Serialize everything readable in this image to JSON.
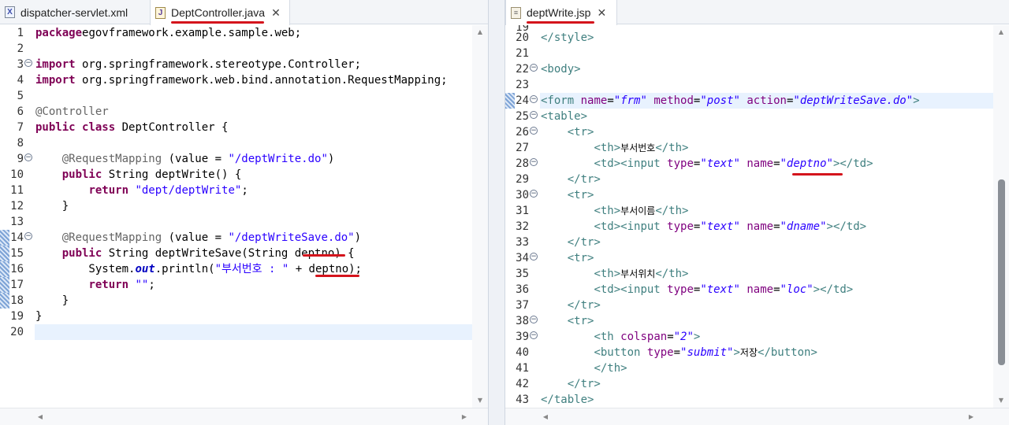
{
  "left_editor": {
    "tabs": [
      {
        "label": "dispatcher-servlet.xml",
        "icon": "xml-file-icon",
        "active": false
      },
      {
        "label": "DeptController.java",
        "icon": "java-file-icon",
        "active": true
      }
    ],
    "lines": [
      {
        "n": "1",
        "parts": [
          [
            "kw",
            "package"
          ],
          [
            "",
            "egovframework.example.sample.web;"
          ]
        ]
      },
      {
        "n": "2",
        "parts": []
      },
      {
        "n": "3",
        "fold": true,
        "parts": [
          [
            "kw",
            "import"
          ],
          [
            "",
            " org.springframework.stereotype.Controller;"
          ]
        ]
      },
      {
        "n": "4",
        "parts": [
          [
            "kw",
            "import"
          ],
          [
            "",
            " org.springframework.web.bind.annotation.RequestMapping;"
          ]
        ]
      },
      {
        "n": "5",
        "parts": []
      },
      {
        "n": "6",
        "parts": [
          [
            "ann",
            "@Controller"
          ]
        ]
      },
      {
        "n": "7",
        "parts": [
          [
            "kw",
            "public"
          ],
          [
            "",
            " "
          ],
          [
            "kw",
            "class"
          ],
          [
            "",
            " DeptController {"
          ]
        ]
      },
      {
        "n": "8",
        "parts": []
      },
      {
        "n": "9",
        "fold": true,
        "parts": [
          [
            "",
            "    "
          ],
          [
            "ann",
            "@RequestMapping"
          ],
          [
            "",
            " (value = "
          ],
          [
            "str",
            "\"/deptWrite.do\""
          ],
          [
            "",
            ")"
          ]
        ]
      },
      {
        "n": "10",
        "parts": [
          [
            "",
            "    "
          ],
          [
            "kw",
            "public"
          ],
          [
            "",
            " String deptWrite() {"
          ]
        ]
      },
      {
        "n": "11",
        "parts": [
          [
            "",
            "        "
          ],
          [
            "kw",
            "return"
          ],
          [
            "",
            " "
          ],
          [
            "str",
            "\"dept/deptWrite\""
          ],
          [
            "",
            ";"
          ]
        ]
      },
      {
        "n": "12",
        "parts": [
          [
            "",
            "    }"
          ]
        ]
      },
      {
        "n": "13",
        "parts": []
      },
      {
        "n": "14",
        "fold": true,
        "mark": true,
        "parts": [
          [
            "",
            "    "
          ],
          [
            "ann",
            "@RequestMapping"
          ],
          [
            "",
            " (value = "
          ],
          [
            "str",
            "\"/deptWriteSave.do\""
          ],
          [
            "",
            ")"
          ]
        ]
      },
      {
        "n": "15",
        "mark": true,
        "parts": [
          [
            "",
            "    "
          ],
          [
            "kw",
            "public"
          ],
          [
            "",
            " String deptWriteSave(String deptno) {"
          ]
        ]
      },
      {
        "n": "16",
        "mark": true,
        "parts": [
          [
            "",
            "        System."
          ],
          [
            "fld",
            "out"
          ],
          [
            "",
            ".println("
          ],
          [
            "str",
            "\"부서번호 : \""
          ],
          [
            "",
            " + deptno);"
          ]
        ]
      },
      {
        "n": "17",
        "mark": true,
        "parts": [
          [
            "",
            "        "
          ],
          [
            "kw",
            "return"
          ],
          [
            "",
            " "
          ],
          [
            "str",
            "\"\""
          ],
          [
            "",
            ";"
          ]
        ]
      },
      {
        "n": "18",
        "mark": true,
        "parts": [
          [
            "",
            "    }"
          ]
        ]
      },
      {
        "n": "19",
        "parts": [
          [
            "",
            "}"
          ]
        ]
      },
      {
        "n": "20",
        "current": true,
        "parts": []
      }
    ]
  },
  "right_editor": {
    "tabs": [
      {
        "label": "deptWrite.jsp",
        "icon": "jsp-file-icon",
        "active": true
      }
    ],
    "partial_top_line": "19",
    "lines": [
      {
        "n": "20",
        "parts": [
          [
            "tag",
            "</style>"
          ]
        ]
      },
      {
        "n": "21",
        "parts": []
      },
      {
        "n": "22",
        "fold": true,
        "parts": [
          [
            "tag",
            "<body>"
          ]
        ]
      },
      {
        "n": "23",
        "parts": []
      },
      {
        "n": "24",
        "fold": true,
        "mark": true,
        "current": true,
        "parts": [
          [
            "tag",
            "<form"
          ],
          [
            "",
            " "
          ],
          [
            "att",
            "name"
          ],
          [
            "",
            "="
          ],
          [
            "aval",
            "\"frm\""
          ],
          [
            "",
            " "
          ],
          [
            "att",
            "method"
          ],
          [
            "",
            "="
          ],
          [
            "aval",
            "\"post\""
          ],
          [
            "",
            " "
          ],
          [
            "att",
            "action"
          ],
          [
            "",
            "="
          ],
          [
            "aval",
            "\"deptWriteSave.do\""
          ],
          [
            "tag",
            ">"
          ]
        ]
      },
      {
        "n": "25",
        "fold": true,
        "parts": [
          [
            "tag",
            "<table>"
          ]
        ]
      },
      {
        "n": "26",
        "fold": true,
        "parts": [
          [
            "",
            "    "
          ],
          [
            "tag",
            "<tr>"
          ]
        ]
      },
      {
        "n": "27",
        "parts": [
          [
            "",
            "        "
          ],
          [
            "tag",
            "<th>"
          ],
          [
            "ko",
            "부서번호"
          ],
          [
            "tag",
            "</th>"
          ]
        ]
      },
      {
        "n": "28",
        "fold": true,
        "parts": [
          [
            "",
            "        "
          ],
          [
            "tag",
            "<td><input"
          ],
          [
            "",
            " "
          ],
          [
            "att",
            "type"
          ],
          [
            "",
            "="
          ],
          [
            "aval",
            "\"text\""
          ],
          [
            "",
            " "
          ],
          [
            "att",
            "name"
          ],
          [
            "",
            "="
          ],
          [
            "aval",
            "\"deptno\""
          ],
          [
            "tag",
            "></td>"
          ]
        ]
      },
      {
        "n": "29",
        "parts": [
          [
            "",
            "    "
          ],
          [
            "tag",
            "</tr>"
          ]
        ]
      },
      {
        "n": "30",
        "fold": true,
        "parts": [
          [
            "",
            "    "
          ],
          [
            "tag",
            "<tr>"
          ]
        ]
      },
      {
        "n": "31",
        "parts": [
          [
            "",
            "        "
          ],
          [
            "tag",
            "<th>"
          ],
          [
            "ko",
            "부서이름"
          ],
          [
            "tag",
            "</th>"
          ]
        ]
      },
      {
        "n": "32",
        "parts": [
          [
            "",
            "        "
          ],
          [
            "tag",
            "<td><input"
          ],
          [
            "",
            " "
          ],
          [
            "att",
            "type"
          ],
          [
            "",
            "="
          ],
          [
            "aval",
            "\"text\""
          ],
          [
            "",
            " "
          ],
          [
            "att",
            "name"
          ],
          [
            "",
            "="
          ],
          [
            "aval",
            "\"dname\""
          ],
          [
            "tag",
            "></td>"
          ]
        ]
      },
      {
        "n": "33",
        "parts": [
          [
            "",
            "    "
          ],
          [
            "tag",
            "</tr>"
          ]
        ]
      },
      {
        "n": "34",
        "fold": true,
        "parts": [
          [
            "",
            "    "
          ],
          [
            "tag",
            "<tr>"
          ]
        ]
      },
      {
        "n": "35",
        "parts": [
          [
            "",
            "        "
          ],
          [
            "tag",
            "<th>"
          ],
          [
            "ko",
            "부서위치"
          ],
          [
            "tag",
            "</th>"
          ]
        ]
      },
      {
        "n": "36",
        "parts": [
          [
            "",
            "        "
          ],
          [
            "tag",
            "<td><input"
          ],
          [
            "",
            " "
          ],
          [
            "att",
            "type"
          ],
          [
            "",
            "="
          ],
          [
            "aval",
            "\"text\""
          ],
          [
            "",
            " "
          ],
          [
            "att",
            "name"
          ],
          [
            "",
            "="
          ],
          [
            "aval",
            "\"loc\""
          ],
          [
            "tag",
            "></td>"
          ]
        ]
      },
      {
        "n": "37",
        "parts": [
          [
            "",
            "    "
          ],
          [
            "tag",
            "</tr>"
          ]
        ]
      },
      {
        "n": "38",
        "fold": true,
        "parts": [
          [
            "",
            "    "
          ],
          [
            "tag",
            "<tr>"
          ]
        ]
      },
      {
        "n": "39",
        "fold": true,
        "parts": [
          [
            "",
            "        "
          ],
          [
            "tag",
            "<th"
          ],
          [
            "",
            " "
          ],
          [
            "att",
            "colspan"
          ],
          [
            "",
            "="
          ],
          [
            "aval",
            "\"2\""
          ],
          [
            "tag",
            ">"
          ]
        ]
      },
      {
        "n": "40",
        "parts": [
          [
            "",
            "        "
          ],
          [
            "tag",
            "<button"
          ],
          [
            "",
            " "
          ],
          [
            "att",
            "type"
          ],
          [
            "",
            "="
          ],
          [
            "aval",
            "\"submit\""
          ],
          [
            "tag",
            ">"
          ],
          [
            "ko",
            "저장"
          ],
          [
            "tag",
            "</button>"
          ]
        ]
      },
      {
        "n": "41",
        "parts": [
          [
            "",
            "        "
          ],
          [
            "tag",
            "</th>"
          ]
        ]
      },
      {
        "n": "42",
        "parts": [
          [
            "",
            "    "
          ],
          [
            "tag",
            "</tr>"
          ]
        ]
      },
      {
        "n": "43",
        "parts": [
          [
            "tag",
            "</table>"
          ]
        ]
      }
    ]
  },
  "colors": {
    "keyword": "#7f0055",
    "string": "#2a00ff",
    "annotation": "#646464",
    "tag": "#3f7f7f",
    "attribute": "#7f007f",
    "highlight_underline": "#d4141c",
    "current_line": "#e8f2fe"
  },
  "icons": {
    "fold_marker": "minus-circle-icon",
    "scroll_up": "▲",
    "scroll_down": "▼",
    "scroll_left": "◀",
    "scroll_right": "▶",
    "tab_close": "✕"
  }
}
